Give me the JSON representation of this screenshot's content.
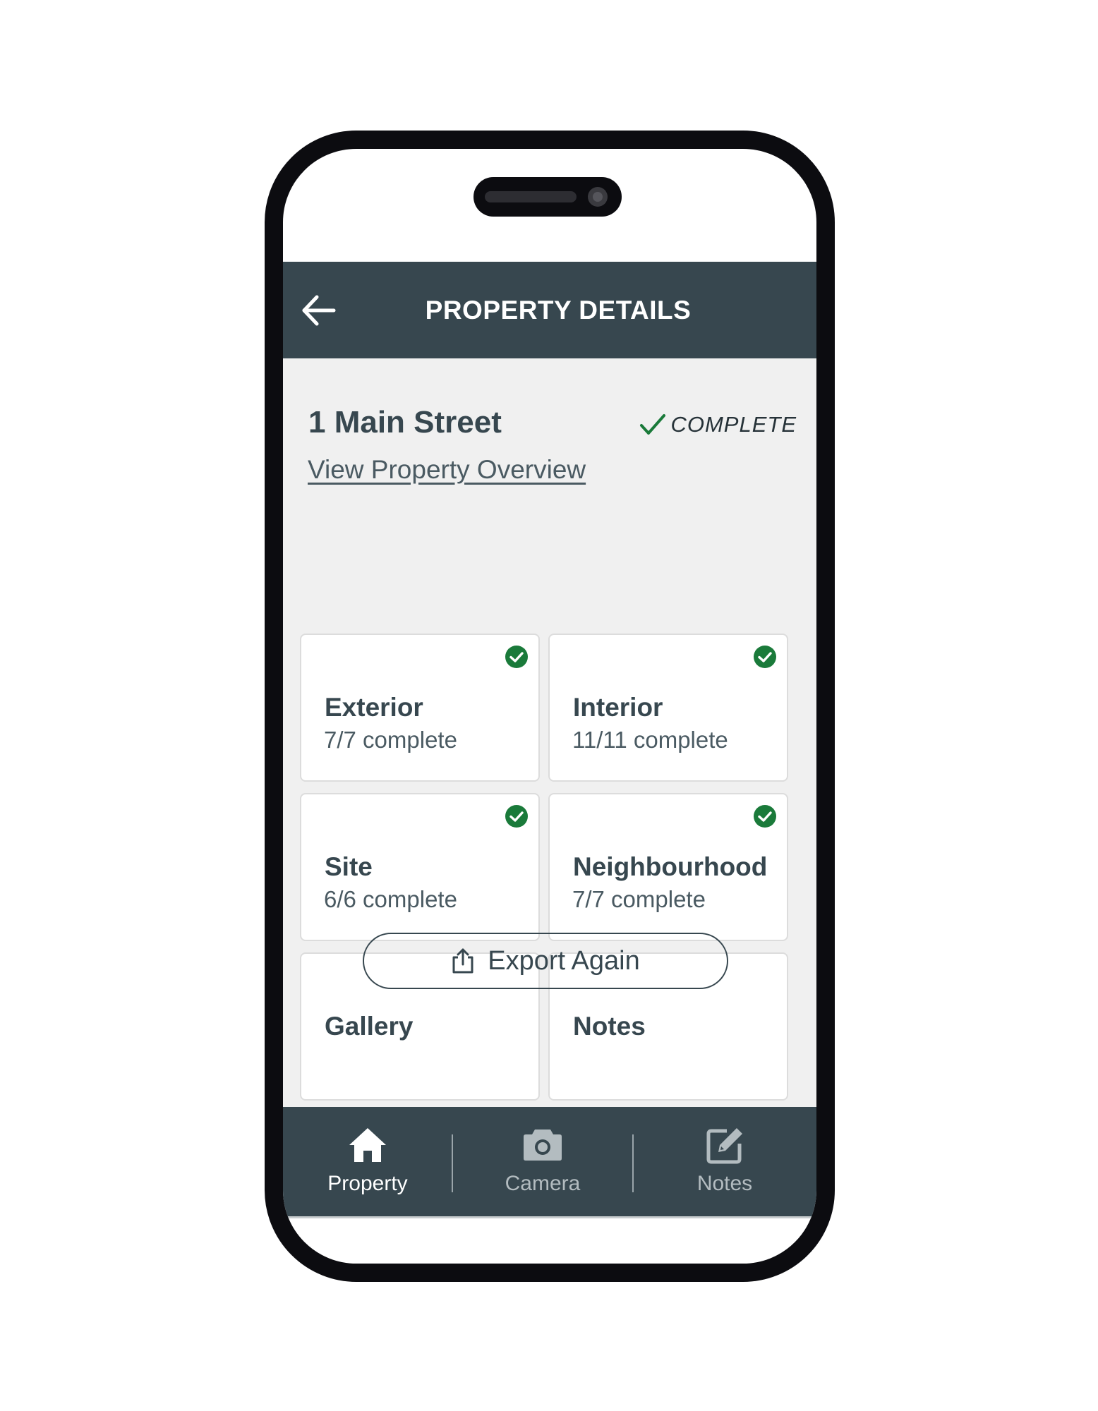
{
  "header": {
    "title": "PROPERTY DETAILS",
    "back_icon": "arrow-left-icon"
  },
  "property": {
    "address": "1 Main Street",
    "status": "COMPLETE",
    "status_icon": "checkmark-icon",
    "overview_link": "View Property Overview"
  },
  "sections": [
    {
      "title": "Exterior",
      "progress": "7/7 complete",
      "completed": true
    },
    {
      "title": "Interior",
      "progress": "11/11 complete",
      "completed": true
    },
    {
      "title": "Site",
      "progress": "6/6 complete",
      "completed": true
    },
    {
      "title": "Neighbourhood",
      "progress": "7/7 complete",
      "completed": true
    },
    {
      "title": "Gallery"
    },
    {
      "title": "Notes"
    }
  ],
  "export_button": {
    "label": "Export Again",
    "icon": "share-upload-icon"
  },
  "bottom_nav": {
    "items": [
      {
        "label": "Property",
        "icon": "home-icon",
        "active": true
      },
      {
        "label": "Camera",
        "icon": "camera-icon",
        "active": false
      },
      {
        "label": "Notes",
        "icon": "edit-note-icon",
        "active": false
      }
    ]
  },
  "colors": {
    "header_bg": "#37474f",
    "content_bg": "#f0f0f0",
    "success_green": "#1a7a3a",
    "nav_active": "#ffffff",
    "nav_inactive": "#b3bcc0"
  }
}
